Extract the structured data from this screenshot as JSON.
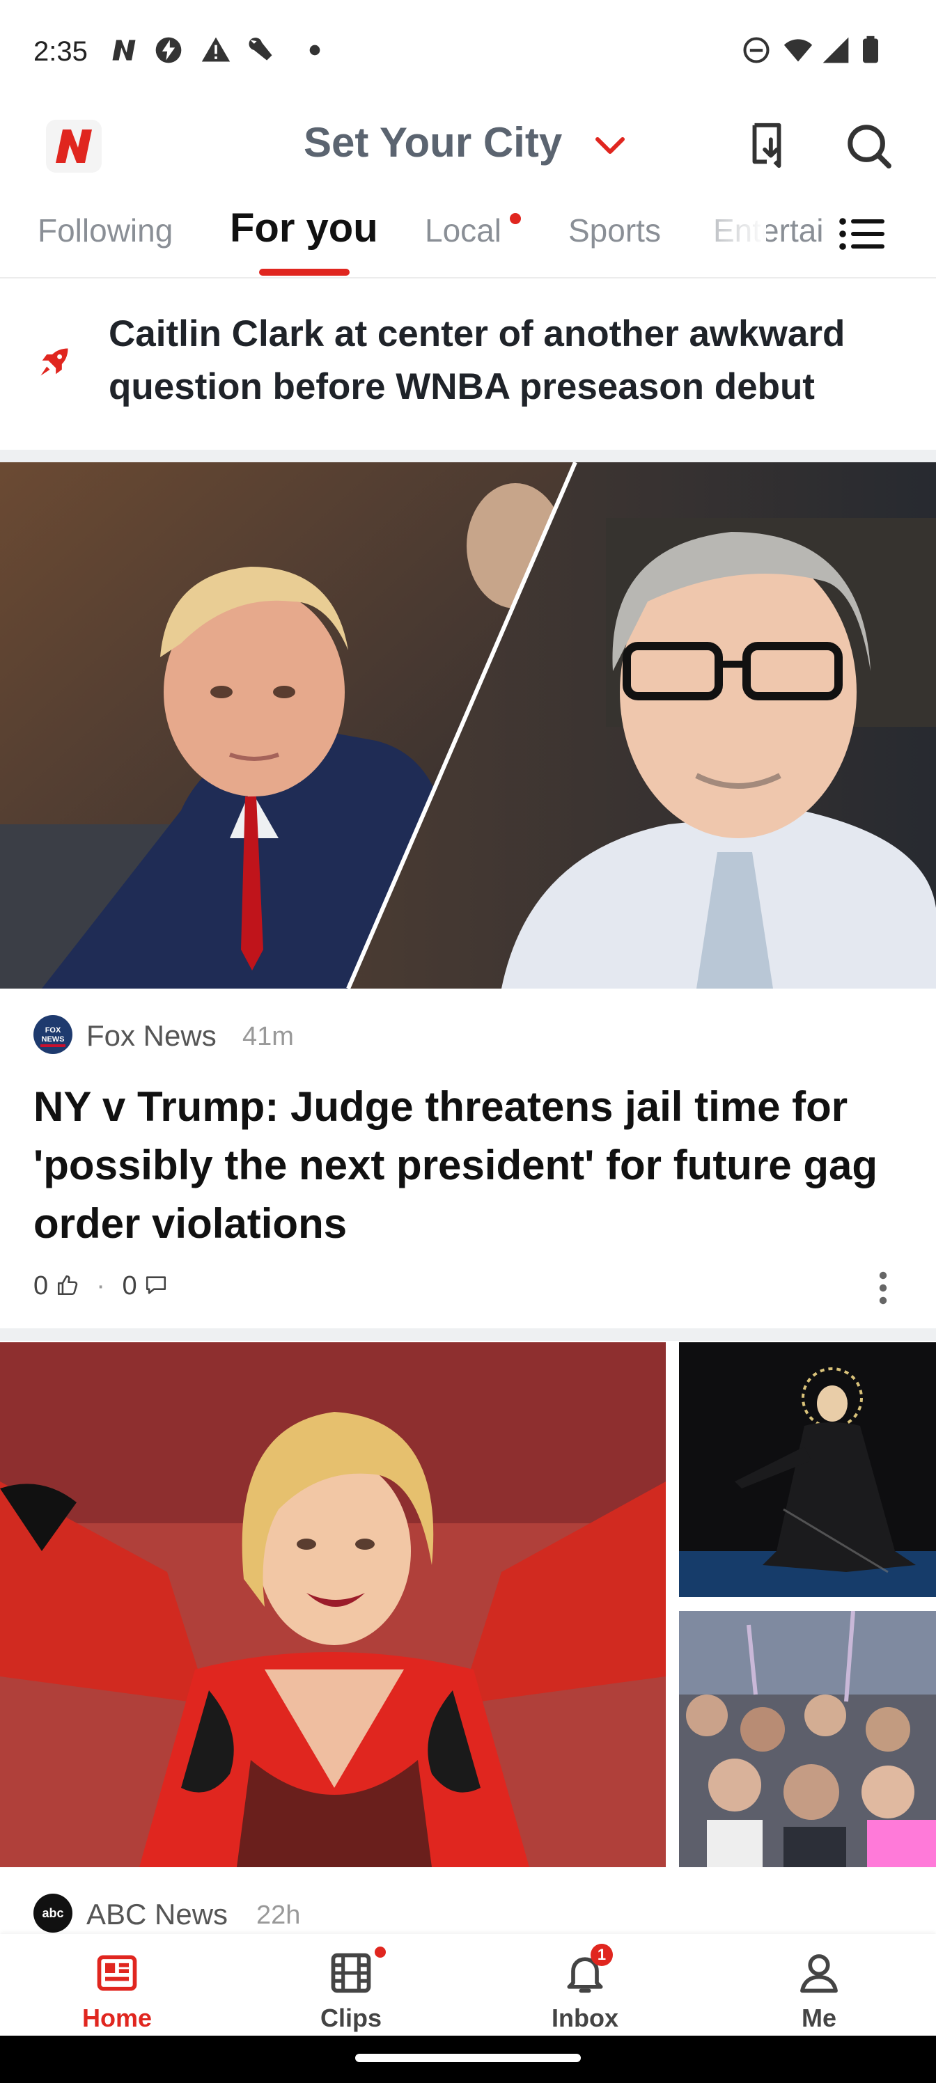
{
  "status_bar": {
    "time": "2:35",
    "left_icons": [
      "n-icon",
      "no-flash-icon",
      "alert-icon",
      "wrench-icon",
      "dot-icon"
    ],
    "right_icons": [
      "dnd-icon",
      "wifi-icon",
      "signal-icon",
      "battery-icon"
    ]
  },
  "header": {
    "logo": "N",
    "city_label": "Set Your City",
    "icons": [
      "bookmark-download-icon",
      "search-icon"
    ]
  },
  "tabs": {
    "items": [
      "Following",
      "For you",
      "Local",
      "Sports",
      "Entertai"
    ],
    "active_index": 1,
    "local_has_dot": true
  },
  "trending": {
    "headline": "Caitlin Clark at center of another awkward question before WNBA preseason debut"
  },
  "article1": {
    "source_name": "Fox News",
    "source_logo_text": "FOX NEWS",
    "time": "41m",
    "headline": "NY v Trump: Judge threatens jail time for 'possibly the next president' for future gag order violations",
    "likes": "0",
    "separator": "·",
    "comments": "0"
  },
  "article2": {
    "source_name": "ABC News",
    "source_logo_text": "abc",
    "time": "22h"
  },
  "bottom_nav": {
    "items": [
      {
        "label": "Home",
        "icon": "home-news-icon"
      },
      {
        "label": "Clips",
        "icon": "film-icon"
      },
      {
        "label": "Inbox",
        "icon": "bell-icon"
      },
      {
        "label": "Me",
        "icon": "person-icon"
      }
    ],
    "active_index": 0,
    "inbox_badge": "1"
  },
  "colors": {
    "accent": "#e0261f",
    "tab_inactive": "#8a8f96",
    "city_text": "#5b6470"
  }
}
